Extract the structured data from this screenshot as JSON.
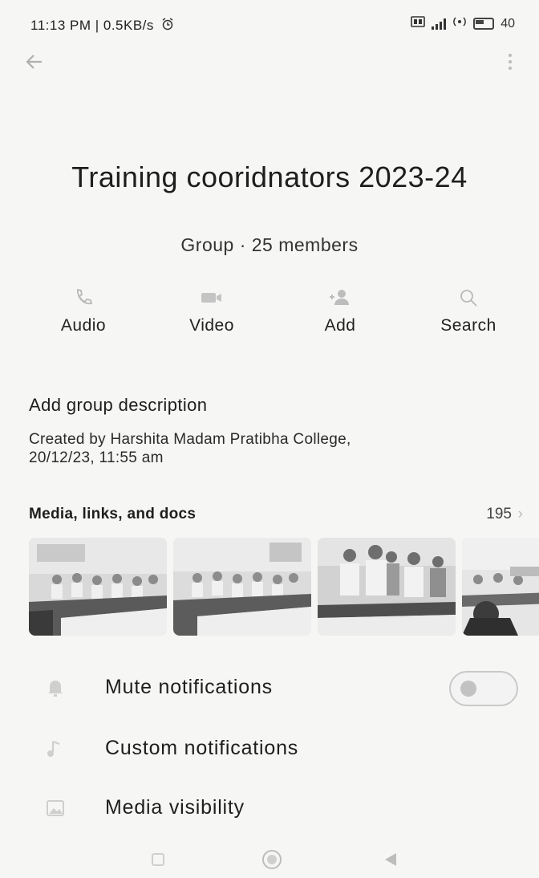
{
  "status_bar": {
    "time_speed": "11:13 PM | 0.5KB/s",
    "alarm_icon": "alarm-icon",
    "battery": "40"
  },
  "app_bar": {
    "back_icon": "arrow-back-icon",
    "menu_icon": "more-vert-icon"
  },
  "group": {
    "name": "Training cooridnators 2023-24",
    "subtitle": "Group · 25 members"
  },
  "actions": [
    {
      "label": "Audio",
      "icon": "phone-icon"
    },
    {
      "label": "Video",
      "icon": "video-camera-icon"
    },
    {
      "label": "Add",
      "icon": "add-person-icon"
    },
    {
      "label": "Search",
      "icon": "search-icon"
    }
  ],
  "description": {
    "add_label": "Add group description",
    "created_line1": "Created by Harshita Madam Pratibha College,",
    "created_line2": "20/12/23, 11:55 am"
  },
  "media": {
    "title": "Media, links, and docs",
    "count": "195",
    "chevron": "›"
  },
  "settings": [
    {
      "label": "Mute notifications",
      "icon": "bell-off-icon",
      "toggle": false
    },
    {
      "label": "Custom notifications",
      "icon": "music-note-icon"
    },
    {
      "label": "Media visibility",
      "icon": "image-icon"
    }
  ],
  "colors": {
    "background": "#f6f6f4",
    "text": "#1c1c1c",
    "icon_muted": "#b5b5b5"
  }
}
